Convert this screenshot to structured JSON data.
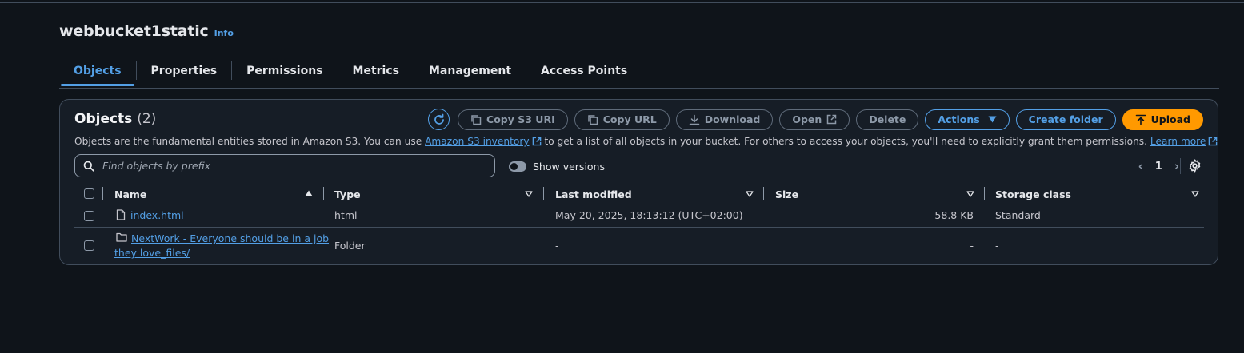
{
  "page": {
    "title": "webbucket1static",
    "info_label": "Info"
  },
  "tabs": [
    "Objects",
    "Properties",
    "Permissions",
    "Metrics",
    "Management",
    "Access Points"
  ],
  "objects_panel": {
    "heading": "Objects",
    "count": "(2)",
    "toolbar": {
      "copy_s3_uri": "Copy S3 URI",
      "copy_url": "Copy URL",
      "download": "Download",
      "open": "Open",
      "delete": "Delete",
      "actions": "Actions",
      "create_folder": "Create folder",
      "upload": "Upload"
    },
    "description": {
      "part1": "Objects are the fundamental entities stored in Amazon S3. You can use ",
      "link1": "Amazon S3 inventory",
      "part2": " to get a list of all objects in your bucket. For others to access your objects, you'll need to explicitly grant them permissions. ",
      "link2": "Learn more"
    },
    "search": {
      "placeholder": "Find objects by prefix"
    },
    "show_versions_label": "Show versions",
    "pagination": {
      "current_page": "1"
    },
    "table": {
      "columns": [
        "Name",
        "Type",
        "Last modified",
        "Size",
        "Storage class"
      ],
      "rows": [
        {
          "name": "index.html",
          "icon": "file-icon",
          "type": "html",
          "last_modified": "May 20, 2025, 18:13:12 (UTC+02:00)",
          "size": "58.8 KB",
          "storage_class": "Standard"
        },
        {
          "name_line1": "NextWork - Everyone should be in a job",
          "name_line2": "they love_files/",
          "icon": "folder-icon",
          "type": "Folder",
          "last_modified": "-",
          "size": "-",
          "storage_class": "-"
        }
      ]
    }
  },
  "colors": {
    "background": "#0f141a",
    "panel": "#161d26",
    "link": "#539fe5",
    "primary": "#ff9900",
    "border": "#414d5c"
  }
}
